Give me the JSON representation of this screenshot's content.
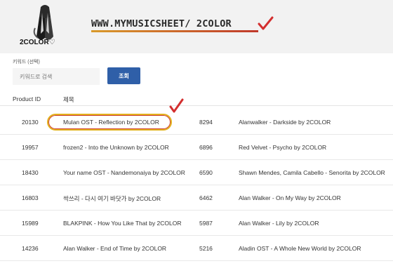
{
  "header": {
    "logo_text": "2COLOR♡",
    "banner_text": "WWW.MYMUSICSHEET/ 2COLOR"
  },
  "search": {
    "label": "키워드 (선택)",
    "placeholder": "키워드로 검색",
    "button_label": "조회"
  },
  "table": {
    "headers": [
      "Product ID",
      "제목"
    ],
    "rows": [
      {
        "id": "20130",
        "title": "Mulan OST - Reflection by 2COLOR",
        "id2": "8294",
        "title2": "Alanwalker - Darkside by 2COLOR"
      },
      {
        "id": "19957",
        "title": "frozen2 - Into the Unknown by 2COLOR",
        "id2": "6896",
        "title2": "Red Velvet - Psycho by 2COLOR"
      },
      {
        "id": "18430",
        "title": "Your name OST - Nandemonaiya by 2COLOR",
        "id2": "6590",
        "title2": "Shawn Mendes, Camila Cabello - Senorita by 2COLOR"
      },
      {
        "id": "16803",
        "title": "싹쓰리 - 다시 여기 바닷가 by 2COLOR",
        "id2": "6462",
        "title2": "Alan Walker - On My Way by 2COLOR"
      },
      {
        "id": "15989",
        "title": "BLAKPINK - How You Like That by 2COLOR",
        "id2": "5987",
        "title2": "Alan Walker - Lily by 2COLOR"
      },
      {
        "id": "14236",
        "title": "Alan Walker - End of Time by 2COLOR",
        "id2": "5216",
        "title2": "Aladin OST - A Whole New World by 2COLOR"
      }
    ]
  },
  "colors": {
    "header_bg": "#f2f2f2",
    "button": "#2f5fa8",
    "highlight": "#e3b21e",
    "check": "#d32f2f"
  }
}
